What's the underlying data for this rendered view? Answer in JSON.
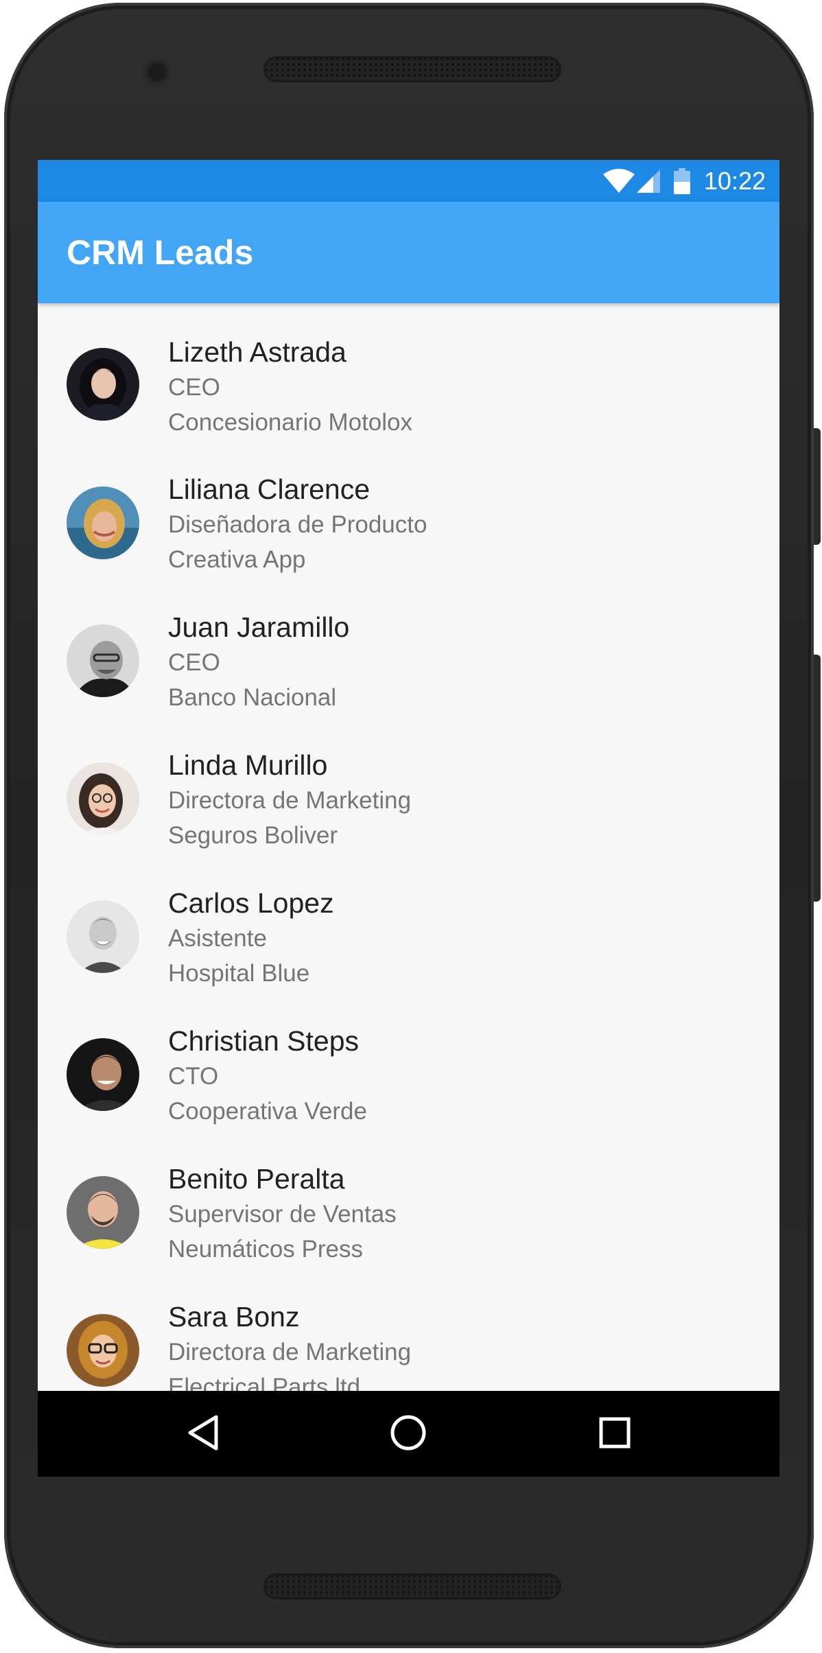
{
  "status_bar": {
    "time": "10:22",
    "color": "#1e88e5"
  },
  "app_bar": {
    "title": "CRM Leads",
    "color": "#42a5f5"
  },
  "leads": [
    {
      "name": "Lizeth Astrada",
      "role": "CEO",
      "company": "Concesionario Motolox",
      "avatar": "avatar-photo"
    },
    {
      "name": "Liliana Clarence",
      "role": "Diseñadora de Producto",
      "company": "Creativa App",
      "avatar": "avatar-photo"
    },
    {
      "name": "Juan Jaramillo",
      "role": "CEO",
      "company": "Banco Nacional",
      "avatar": "avatar-photo"
    },
    {
      "name": "Linda Murillo",
      "role": "Directora de Marketing",
      "company": "Seguros Boliver",
      "avatar": "avatar-photo"
    },
    {
      "name": "Carlos Lopez",
      "role": "Asistente",
      "company": "Hospital Blue",
      "avatar": "avatar-photo"
    },
    {
      "name": "Christian Steps",
      "role": "CTO",
      "company": "Cooperativa Verde",
      "avatar": "avatar-photo"
    },
    {
      "name": "Benito Peralta",
      "role": "Supervisor de Ventas",
      "company": "Neumáticos Press",
      "avatar": "avatar-photo"
    },
    {
      "name": "Sara Bonz",
      "role": "Directora de Marketing",
      "company": "Electrical Parts ltd",
      "avatar": "avatar-photo"
    }
  ],
  "nav_bar": {
    "back": "back-icon",
    "home": "home-icon",
    "recents": "recents-icon"
  }
}
